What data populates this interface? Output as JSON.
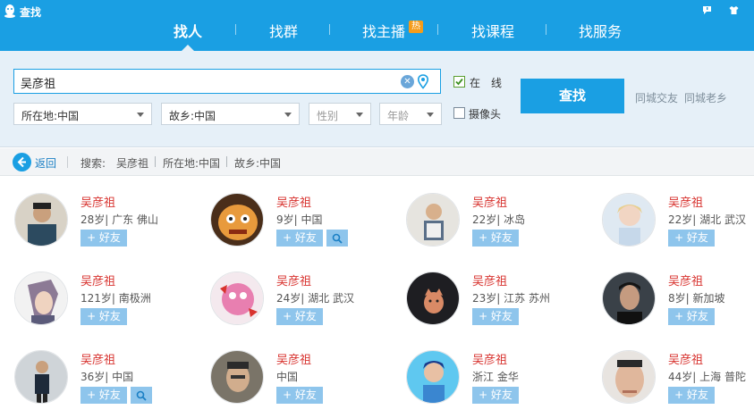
{
  "window": {
    "title": "查找"
  },
  "nav": {
    "tabs": [
      {
        "label": "找人"
      },
      {
        "label": "找群"
      },
      {
        "label": "找主播"
      },
      {
        "label": "找课程"
      },
      {
        "label": "找服务"
      }
    ],
    "hot_badge": "热"
  },
  "search": {
    "name_value": "吴彦祖",
    "location_label": "所在地:中国",
    "hometown_label": "故乡:中国",
    "gender_placeholder": "性别",
    "age_placeholder": "年龄",
    "online_label": "在　线",
    "online_checked": true,
    "camera_label": "摄像头",
    "camera_checked": false,
    "find_button": "查找",
    "link_same_city": "同城交友",
    "link_fellow": "同城老乡"
  },
  "result_bar": {
    "back_label": "返回",
    "search_label": "搜索:",
    "crumbs": [
      "吴彦祖",
      "所在地:中国",
      "故乡:中国"
    ]
  },
  "results": [
    {
      "name": "吴彦祖",
      "info": "28岁| 广东 佛山",
      "add_label": "+ 好友",
      "zoom": false
    },
    {
      "name": "吴彦祖",
      "info": "9岁| 中国",
      "add_label": "+ 好友",
      "zoom": true
    },
    {
      "name": "吴彦祖",
      "info": "22岁| 冰岛",
      "add_label": "+ 好友",
      "zoom": false
    },
    {
      "name": "吴彦祖",
      "info": "22岁| 湖北 武汉",
      "add_label": "+ 好友",
      "zoom": false
    },
    {
      "name": "吴彦祖",
      "info": "121岁| 南极洲",
      "add_label": "+ 好友",
      "zoom": false
    },
    {
      "name": "吴彦祖",
      "info": "24岁| 湖北 武汉",
      "add_label": "+ 好友",
      "zoom": false
    },
    {
      "name": "吴彦祖",
      "info": "23岁| 江苏 苏州",
      "add_label": "+ 好友",
      "zoom": false
    },
    {
      "name": "吴彦祖",
      "info": "8岁| 新加坡",
      "add_label": "+ 好友",
      "zoom": false
    },
    {
      "name": "吴彦祖",
      "info": "36岁| 中国",
      "add_label": "+ 好友",
      "zoom": true
    },
    {
      "name": "吴彦祖",
      "info": "中国",
      "add_label": "+ 好友",
      "zoom": false
    },
    {
      "name": "吴彦祖",
      "info": "浙江 金华",
      "add_label": "+ 好友",
      "zoom": false
    },
    {
      "name": "吴彦祖",
      "info": "44岁| 上海 普陀",
      "add_label": "+ 好友",
      "zoom": false
    }
  ],
  "colors": {
    "brand_blue": "#1a9fe3",
    "name_red": "#d8332f",
    "add_button": "#8ec5ec",
    "panel_bg": "#e6f0f8"
  }
}
